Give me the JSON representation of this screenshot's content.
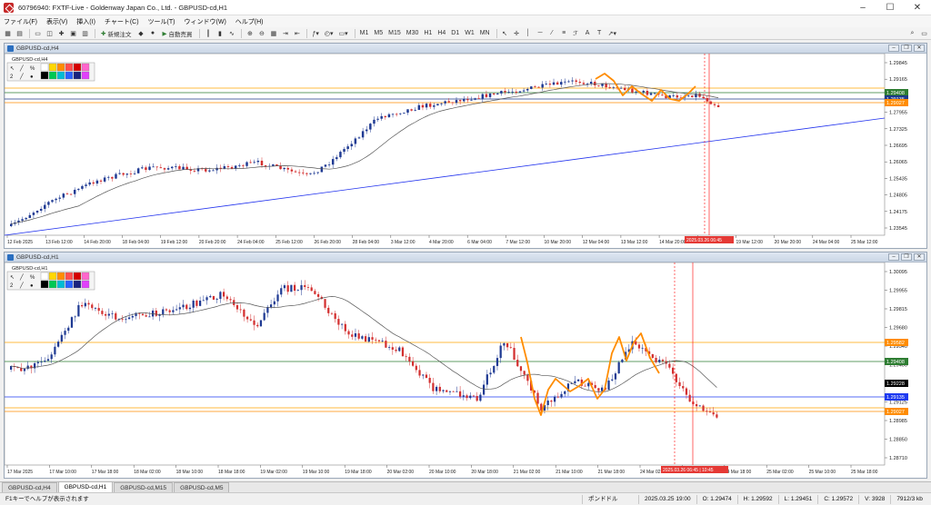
{
  "window": {
    "title": "60796940: FXTF-Live - Goldenway Japan Co., Ltd. - GBPUSD-cd,H1"
  },
  "menu": [
    "ファイル(F)",
    "表示(V)",
    "挿入(I)",
    "チャート(C)",
    "ツール(T)",
    "ウィンドウ(W)",
    "ヘルプ(H)"
  ],
  "toolbar": {
    "new_order": "新規注文",
    "auto_trade": "自動売買",
    "timeframes": [
      "M1",
      "M5",
      "M15",
      "M30",
      "H1",
      "H4",
      "D1",
      "W1",
      "MN"
    ]
  },
  "chart_h4": {
    "window_title": "GBPUSD-cd,H4",
    "inner_label": "GBPUSD-cd,H4",
    "price_labels": [
      "1.29845",
      "1.29165",
      "1.28585",
      "1.27955",
      "1.27325",
      "1.26695",
      "1.26065",
      "1.25435",
      "1.24805",
      "1.24175",
      "1.23545"
    ],
    "tagged_prices": [
      {
        "text": "1.29408",
        "color": "#2e7d32"
      },
      {
        "text": "1.29135",
        "color": "#1e3a8a"
      },
      {
        "text": "1.29027",
        "color": "#ff8c00"
      }
    ],
    "time_labels": [
      "12 Feb 2025",
      "13 Feb 12:00",
      "14 Feb 20:00",
      "18 Feb 04:00",
      "19 Feb 12:00",
      "20 Feb 20:00",
      "24 Feb 04:00",
      "25 Feb 12:00",
      "26 Feb 20:00",
      "28 Feb 04:00",
      "3 Mar 12:00",
      "4 Mar 20:00",
      "6 Mar 04:00",
      "7 Mar 12:00",
      "10 Mar 20:00",
      "12 Mar 04:00",
      "13 Mar 12:00",
      "14 Mar 20:00",
      "18 Mar 04:00",
      "19 Mar 12:00",
      "20 Mar 20:00",
      "24 Mar 04:00",
      "25 Mar 12:00"
    ],
    "cursor_time": "2025.03.26 06:45"
  },
  "chart_h1": {
    "window_title": "GBPUSD-cd,H1",
    "inner_label": "GBPUSD-cd,H1",
    "price_labels": [
      "1.30095",
      "1.29955",
      "1.29815",
      "1.29680",
      "1.29540",
      "1.29400",
      "1.29265",
      "1.29125",
      "1.28985",
      "1.28850",
      "1.28710"
    ],
    "tagged_prices": [
      {
        "text": "1.29582",
        "color": "#ff8c00"
      },
      {
        "text": "1.29408",
        "color": "#2e7d32"
      },
      {
        "text": "1.29228",
        "color": "#000000"
      },
      {
        "text": "1.29135",
        "color": "#1e3af0"
      },
      {
        "text": "1.29027",
        "color": "#ff8c00"
      }
    ],
    "time_labels": [
      "17 Mar 2025",
      "17 Mar 10:00",
      "17 Mar 18:00",
      "18 Mar 02:00",
      "18 Mar 10:00",
      "18 Mar 18:00",
      "19 Mar 02:00",
      "19 Mar 10:00",
      "19 Mar 18:00",
      "20 Mar 02:00",
      "20 Mar 10:00",
      "20 Mar 18:00",
      "21 Mar 02:00",
      "21 Mar 10:00",
      "21 Mar 18:00",
      "24 Mar 02:00",
      "24 Mar 10:00",
      "24 Mar 18:00",
      "25 Mar 02:00",
      "25 Mar 10:00",
      "25 Mar 18:00"
    ],
    "cursor_time": "2025.03.26 06:45 | 10:45"
  },
  "tabs": [
    "GBPUSD-cd,H4",
    "GBPUSD-cd,H1",
    "GBPUSD-cd,M15",
    "GBPUSD-cd,M5"
  ],
  "status": {
    "help": "F1キーでヘルプが表示されます",
    "profile": "ポンドドル",
    "datetime": "2025.03.25 19:00",
    "open": "O: 1.29474",
    "high": "H: 1.29592",
    "low": "L: 1.29451",
    "close": "C: 1.29572",
    "volume": "V: 3928",
    "traffic": "7912/3 kb"
  },
  "colors": {
    "bull": "#1f3a93",
    "bear": "#d32f2f",
    "ma": "#555555",
    "trend": "#2233ee",
    "orange": "#ff8c00",
    "green": "#2e7d32",
    "cursor": "#ff0000"
  }
}
